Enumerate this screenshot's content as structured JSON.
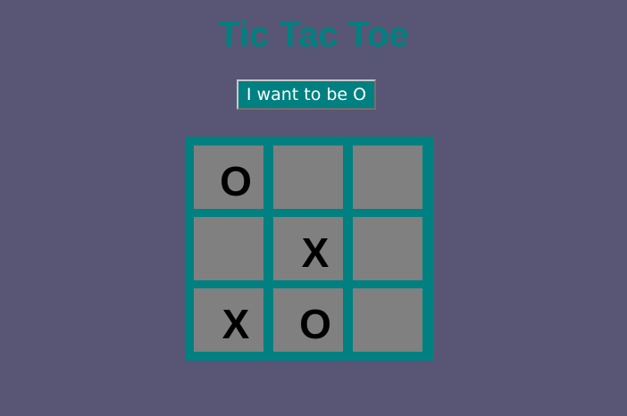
{
  "title": "Tic Tac Toe",
  "choose_button": {
    "label": "I want to be O"
  },
  "board": {
    "cells": [
      {
        "row": 1,
        "col": 1,
        "mark": "O"
      },
      {
        "row": 1,
        "col": 2,
        "mark": ""
      },
      {
        "row": 1,
        "col": 3,
        "mark": ""
      },
      {
        "row": 2,
        "col": 1,
        "mark": ""
      },
      {
        "row": 2,
        "col": 2,
        "mark": "X"
      },
      {
        "row": 2,
        "col": 3,
        "mark": ""
      },
      {
        "row": 3,
        "col": 1,
        "mark": "X"
      },
      {
        "row": 3,
        "col": 2,
        "mark": "O"
      },
      {
        "row": 3,
        "col": 3,
        "mark": ""
      }
    ]
  },
  "colors": {
    "background": "#585674",
    "accent": "#008080",
    "cell": "#808080",
    "mark": "#000000",
    "button_text": "#ffffff"
  }
}
